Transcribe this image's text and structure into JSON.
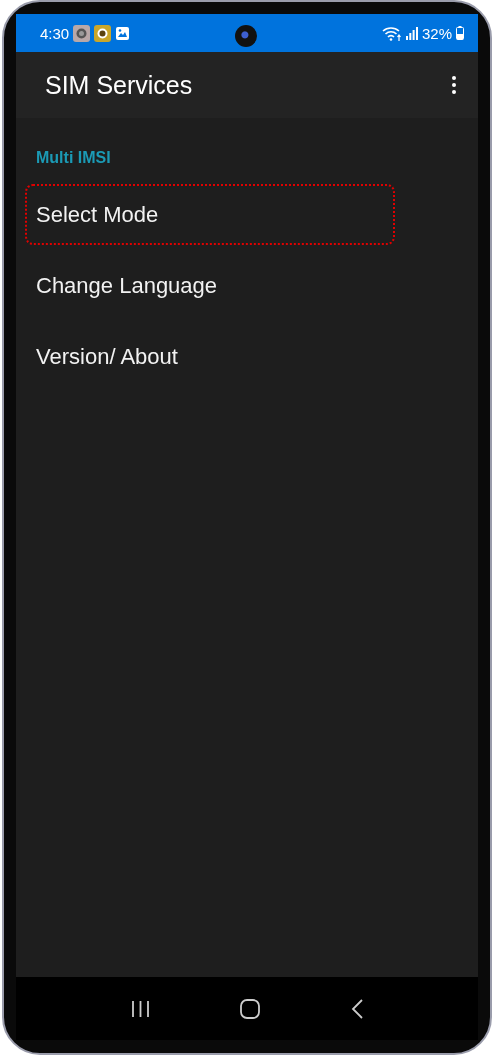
{
  "status_bar": {
    "time": "4:30",
    "battery": "32%"
  },
  "app_bar": {
    "title": "SIM Services"
  },
  "section": {
    "title": "Multi IMSI"
  },
  "items": [
    {
      "label": "Select Mode",
      "highlighted": true
    },
    {
      "label": "Change Language",
      "highlighted": false
    },
    {
      "label": "Version/ About",
      "highlighted": false
    }
  ]
}
